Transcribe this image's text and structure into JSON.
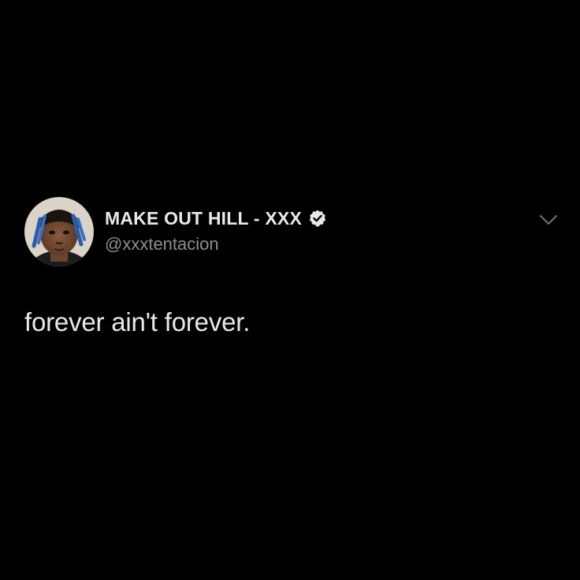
{
  "tweet": {
    "author": {
      "display_name": "MAKE OUT HILL - XXX",
      "handle": "@xxxtentacion",
      "verified": true,
      "avatar_icon": "profile-photo"
    },
    "text": "forever ain't forever.",
    "menu_icon": "chevron-down-icon"
  },
  "colors": {
    "background": "#000000",
    "primary_text": "#e7e9ea",
    "secondary_text": "#8b8f93"
  }
}
